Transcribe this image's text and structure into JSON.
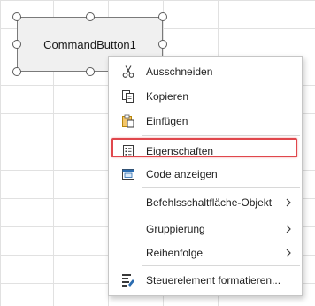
{
  "command_button": {
    "label": "CommandButton1"
  },
  "context_menu": {
    "items": [
      {
        "label": "Ausschneiden",
        "icon": "scissors-icon"
      },
      {
        "label": "Kopieren",
        "icon": "copy-icon"
      },
      {
        "label": "Einfügen",
        "icon": "paste-icon"
      },
      {
        "label": "Eigenschaften",
        "icon": "properties-icon",
        "highlighted": true
      },
      {
        "label": "Code anzeigen",
        "icon": "view-code-icon"
      },
      {
        "label": "Befehlsschaltfläche-Objekt",
        "has_submenu": true
      },
      {
        "label": "Gruppierung",
        "has_submenu": true
      },
      {
        "label": "Reihenfolge",
        "has_submenu": true
      },
      {
        "label": "Steuerelement formatieren...",
        "icon": "format-control-icon"
      }
    ]
  },
  "colors": {
    "highlight_border": "#e0474c",
    "grid_line": "#e1e1e1",
    "button_face": "#f0f0f0"
  }
}
